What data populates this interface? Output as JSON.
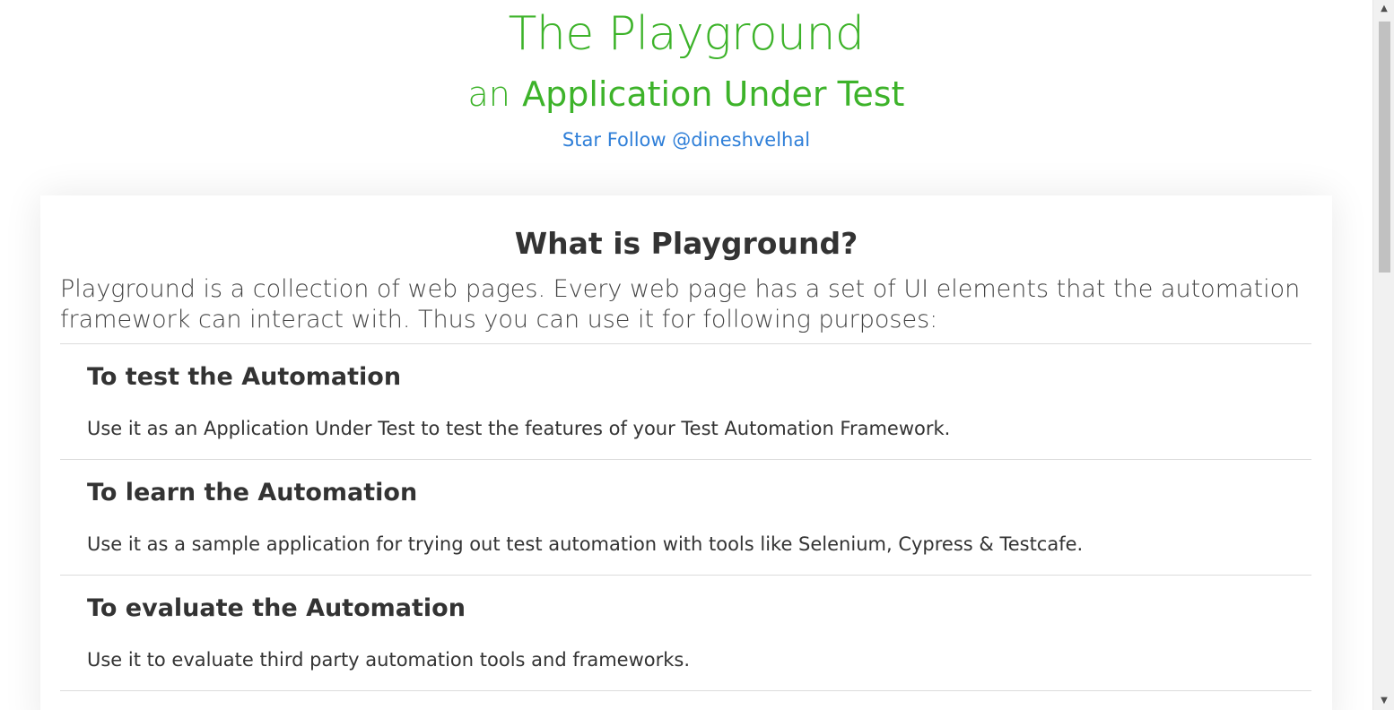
{
  "header": {
    "title": "The Playground",
    "subtitle_prefix": "an",
    "subtitle_main": "Application Under Test",
    "links": {
      "star": "Star",
      "follow": "Follow @dineshvelhal"
    }
  },
  "main": {
    "heading": "What is Playground?",
    "intro": "Playground is a collection of web pages. Every web page has a set of UI elements that the automation framework can interact with. Thus you can use it for following purposes:",
    "purposes": [
      {
        "title": "To test the Automation",
        "description": "Use it as an Application Under Test to test the features of your Test Automation Framework."
      },
      {
        "title": "To learn the Automation",
        "description": "Use it as a sample application for trying out test automation with tools like Selenium, Cypress & Testcafe."
      },
      {
        "title": "To evaluate the Automation",
        "description": "Use it to evaluate third party automation tools and frameworks."
      }
    ]
  },
  "scrollbar": {
    "up_icon": "▲",
    "down_icon": "▼"
  },
  "colors": {
    "brand_green": "#3db32a",
    "link_blue": "#2f7fd8",
    "text_dark": "#333333",
    "divider": "#dcdcdc"
  }
}
